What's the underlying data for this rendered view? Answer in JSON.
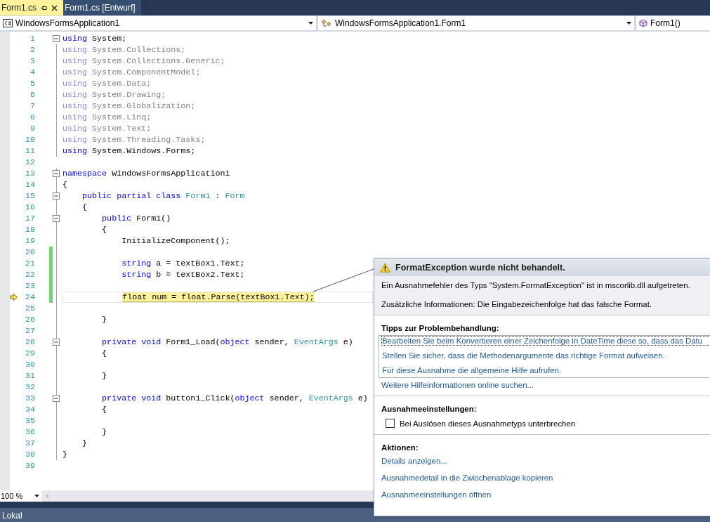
{
  "tabs": [
    {
      "label": "Form1.cs",
      "selected": true
    },
    {
      "label": "Form1.cs [Entwurf]",
      "selected": false
    }
  ],
  "navigation": [
    {
      "label": "WindowsFormsApplication1",
      "kind": "project"
    },
    {
      "label": "WindowsFormsApplication1.Form1",
      "kind": "class"
    },
    {
      "label": "Form1()",
      "kind": "method"
    }
  ],
  "editor": {
    "lines": [
      {
        "number": "1",
        "fold": true,
        "tokens": [
          {
            "kind": "keyword",
            "text": "using"
          },
          {
            "kind": "plain",
            "text": " System;"
          }
        ]
      },
      {
        "number": "2",
        "tokens": [
          {
            "kind": "faded-keyword",
            "text": "using"
          },
          {
            "kind": "faded",
            "text": " System.Collections;"
          }
        ]
      },
      {
        "number": "3",
        "tokens": [
          {
            "kind": "faded-keyword",
            "text": "using"
          },
          {
            "kind": "faded",
            "text": " System.Collections.Generic;"
          }
        ]
      },
      {
        "number": "4",
        "tokens": [
          {
            "kind": "faded-keyword",
            "text": "using"
          },
          {
            "kind": "faded",
            "text": " System.ComponentModel;"
          }
        ]
      },
      {
        "number": "5",
        "tokens": [
          {
            "kind": "faded-keyword",
            "text": "using"
          },
          {
            "kind": "faded",
            "text": " System.Data;"
          }
        ]
      },
      {
        "number": "6",
        "tokens": [
          {
            "kind": "faded-keyword",
            "text": "using"
          },
          {
            "kind": "faded",
            "text": " System.Drawing;"
          }
        ]
      },
      {
        "number": "7",
        "tokens": [
          {
            "kind": "faded-keyword",
            "text": "using"
          },
          {
            "kind": "faded",
            "text": " System.Globalization;"
          }
        ]
      },
      {
        "number": "8",
        "tokens": [
          {
            "kind": "faded-keyword",
            "text": "using"
          },
          {
            "kind": "faded",
            "text": " System.Linq;"
          }
        ]
      },
      {
        "number": "9",
        "tokens": [
          {
            "kind": "faded-keyword",
            "text": "using"
          },
          {
            "kind": "faded",
            "text": " System.Text;"
          }
        ]
      },
      {
        "number": "10",
        "tokens": [
          {
            "kind": "faded-keyword",
            "text": "using"
          },
          {
            "kind": "faded",
            "text": " System.Threading.Tasks;"
          }
        ]
      },
      {
        "number": "11",
        "tokens": [
          {
            "kind": "keyword",
            "text": "using"
          },
          {
            "kind": "plain",
            "text": " System.Windows.Forms;"
          }
        ]
      },
      {
        "number": "12"
      },
      {
        "number": "13",
        "fold": true,
        "tokens": [
          {
            "kind": "keyword",
            "text": "namespace"
          },
          {
            "kind": "plain",
            "text": " WindowsFormsApplication1"
          }
        ]
      },
      {
        "number": "14",
        "tokens": [
          {
            "kind": "plain",
            "text": "{"
          }
        ]
      },
      {
        "number": "15",
        "fold": true,
        "tokens": [
          {
            "kind": "keyword",
            "text": "    public partial class"
          },
          {
            "kind": "type",
            "text": " Form1"
          },
          {
            "kind": "plain",
            "text": " : "
          },
          {
            "kind": "type",
            "text": "Form"
          }
        ]
      },
      {
        "number": "16",
        "tokens": [
          {
            "kind": "plain",
            "text": "    {"
          }
        ]
      },
      {
        "number": "17",
        "fold": true,
        "tokens": [
          {
            "kind": "keyword",
            "text": "        public"
          },
          {
            "kind": "plain",
            "text": " Form1()"
          }
        ]
      },
      {
        "number": "18",
        "tokens": [
          {
            "kind": "plain",
            "text": "        {"
          }
        ]
      },
      {
        "number": "19",
        "tokens": [
          {
            "kind": "plain",
            "text": "            InitializeComponent();"
          }
        ]
      },
      {
        "number": "20",
        "changed": true
      },
      {
        "number": "21",
        "changed": true,
        "tokens": [
          {
            "kind": "keyword",
            "text": "            string"
          },
          {
            "kind": "plain",
            "text": " a = textBox1.Text;"
          }
        ]
      },
      {
        "number": "22",
        "changed": true,
        "tokens": [
          {
            "kind": "keyword",
            "text": "            string"
          },
          {
            "kind": "plain",
            "text": " b = textBox2.Text;"
          }
        ]
      },
      {
        "number": "23",
        "changed": true
      },
      {
        "number": "24",
        "changed": true,
        "current": true,
        "tokens": [
          {
            "kind": "plain",
            "text": "            float num = float.Parse(textBox1.Text);"
          }
        ]
      },
      {
        "number": "25"
      },
      {
        "number": "26",
        "tokens": [
          {
            "kind": "plain",
            "text": "        }"
          }
        ]
      },
      {
        "number": "27"
      },
      {
        "number": "28",
        "fold": true,
        "tokens": [
          {
            "kind": "keyword",
            "text": "        private void"
          },
          {
            "kind": "plain",
            "text": " Form1_Load("
          },
          {
            "kind": "keyword",
            "text": "object"
          },
          {
            "kind": "plain",
            "text": " sender, "
          },
          {
            "kind": "type",
            "text": "EventArgs"
          },
          {
            "kind": "plain",
            "text": " e)"
          }
        ]
      },
      {
        "number": "29",
        "tokens": [
          {
            "kind": "plain",
            "text": "        {"
          }
        ]
      },
      {
        "number": "30"
      },
      {
        "number": "31",
        "tokens": [
          {
            "kind": "plain",
            "text": "        }"
          }
        ]
      },
      {
        "number": "32"
      },
      {
        "number": "33",
        "fold": true,
        "tokens": [
          {
            "kind": "keyword",
            "text": "        private void"
          },
          {
            "kind": "plain",
            "text": " button1_Click("
          },
          {
            "kind": "keyword",
            "text": "object"
          },
          {
            "kind": "plain",
            "text": " sender, "
          },
          {
            "kind": "type",
            "text": "EventArgs"
          },
          {
            "kind": "plain",
            "text": " e)"
          }
        ]
      },
      {
        "number": "34",
        "tokens": [
          {
            "kind": "plain",
            "text": "        {"
          }
        ]
      },
      {
        "number": "35"
      },
      {
        "number": "36",
        "tokens": [
          {
            "kind": "plain",
            "text": "        }"
          }
        ]
      },
      {
        "number": "37",
        "tokens": [
          {
            "kind": "plain",
            "text": "    }"
          }
        ]
      },
      {
        "number": "38",
        "tokens": [
          {
            "kind": "plain",
            "text": "}"
          }
        ]
      },
      {
        "number": "39"
      }
    ],
    "zoom": "100 %"
  },
  "exception_popup": {
    "title": "FormatException wurde nicht behandelt.",
    "messages": [
      "Ein Ausnahmefehler des Typs \"System.FormatException\" ist in mscorlib.dll aufgetreten.",
      "Zusätzliche Informationen: Die Eingabezeichenfolge hat das falsche Format."
    ],
    "tips_heading": "Tipps zur Problembehandlung:",
    "tips": [
      {
        "text": "Bearbeiten Sie beim Konvertieren einer Zeichenfolge in DateTime diese so, dass das Datu",
        "focused": true
      },
      {
        "text": "Stellen Sie sicher, dass die Methodenargumente das richtige Format aufweisen.",
        "focused": false
      },
      {
        "text": "Für diese Ausnahme die allgemeine Hilfe aufrufen.",
        "focused": false
      }
    ],
    "online_help": "Weitere Hilfeinformationen online suchen...",
    "settings_heading": "Ausnahmeeinstellungen:",
    "break_option": {
      "label": "Bei Auslösen dieses Ausnahmetyps unterbrechen",
      "checked": false
    },
    "actions_heading": "Aktionen:",
    "actions": [
      "Details anzeigen...",
      "Ausnahmedetail in die Zwischenablage kopieren",
      "Ausnahmeeinstellungen öffnen"
    ]
  },
  "status_bar": {
    "text": "Lokal"
  }
}
